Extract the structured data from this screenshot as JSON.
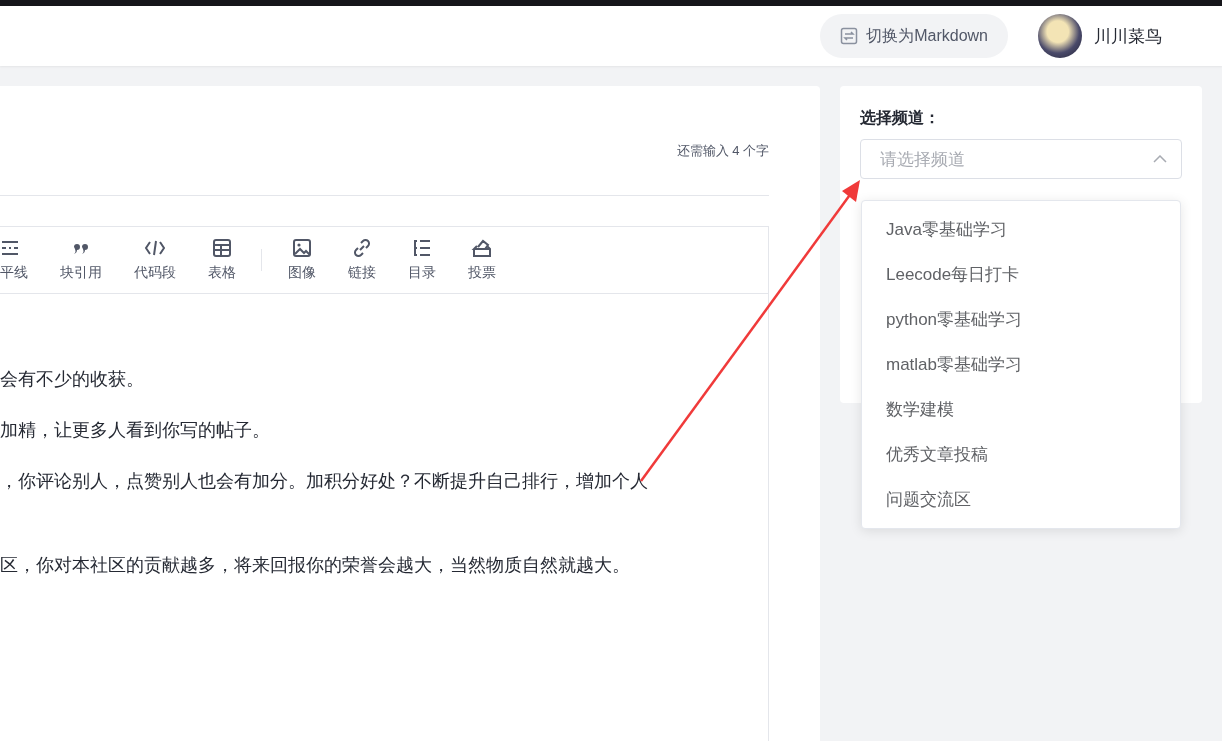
{
  "header": {
    "switch_button": "切换为Markdown",
    "user_name": "川川菜鸟"
  },
  "editor": {
    "remaining_count": "还需输入 4 个字",
    "toolbar": [
      {
        "kind": "hr",
        "label": "平线"
      },
      {
        "kind": "quote",
        "label": "块引用"
      },
      {
        "kind": "code",
        "label": "代码段"
      },
      {
        "kind": "table",
        "label": "表格"
      },
      {
        "kind": "separator"
      },
      {
        "kind": "image",
        "label": "图像"
      },
      {
        "kind": "link",
        "label": "链接"
      },
      {
        "kind": "toc",
        "label": "目录"
      },
      {
        "kind": "vote",
        "label": "投票"
      }
    ],
    "paragraphs": [
      "会有不少的收获。",
      "加精，让更多人看到你写的帖子。",
      "，你评论别人，点赞别人也会有加分。加积分好处？不断提升自己排行，增加个人",
      "区，你对本社区的贡献越多，将来回报你的荣誉会越大，当然物质自然就越大。"
    ]
  },
  "channel": {
    "label": "选择频道：",
    "placeholder": "请选择频道",
    "expanded": true,
    "options": [
      "Java零基础学习",
      "Leecode每日打卡",
      "python零基础学习",
      "matlab零基础学习",
      "数学建模",
      "优秀文章投稿",
      "问题交流区"
    ]
  }
}
